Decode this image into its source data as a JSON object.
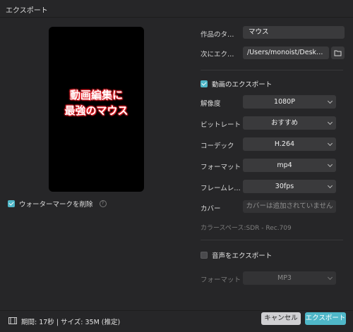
{
  "window": {
    "title": "エクスポート"
  },
  "preview": {
    "caption_line1": "動画編集に",
    "caption_line2": "最強のマウス"
  },
  "watermark": {
    "label": "ウォーターマークを削除",
    "checked": true,
    "help_icon": "?"
  },
  "settings": {
    "title_label": "作品のタ…",
    "title_value": "マウス",
    "export_to_label": "次にエク…",
    "export_to_value": "/Users/monoist/Desk…",
    "folder_icon": "folder-icon"
  },
  "video": {
    "section_label": "動画のエクスポート",
    "checked": true,
    "resolution_label": "解像度",
    "resolution_value": "1080P",
    "bitrate_label": "ビットレート",
    "bitrate_value": "おすすめ",
    "codec_label": "コーデック",
    "codec_value": "H.264",
    "format_label": "フォーマット",
    "format_value": "mp4",
    "framerate_label": "フレームレ…",
    "framerate_value": "30fps",
    "cover_label": "カバー",
    "cover_placeholder": "カバーは追加されていません",
    "colorspace": "カラースペース:SDR - Rec.709"
  },
  "audio": {
    "section_label": "音声をエクスポート",
    "checked": false,
    "format_label": "フォーマット",
    "format_value": "MP3"
  },
  "footer": {
    "info": "期間: 17秒 | サイズ: 35M (推定)",
    "cancel_label": "キャンセル",
    "export_label": "エクスポート"
  },
  "colors": {
    "accent": "#4fb7c8",
    "background": "#262628",
    "field": "#3a3a3c",
    "caption_outline": "#e5232b"
  }
}
